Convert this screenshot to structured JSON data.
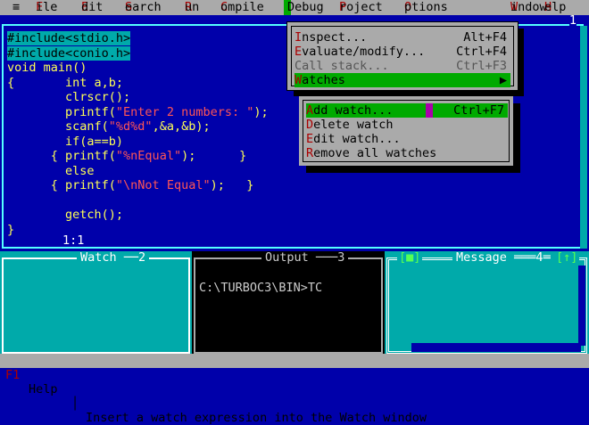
{
  "menubar": {
    "system": "≡",
    "items": [
      {
        "label": "File"
      },
      {
        "label": "Edit"
      },
      {
        "label": "Search"
      },
      {
        "label": "Run"
      },
      {
        "label": "Compile"
      },
      {
        "label": "Debug"
      },
      {
        "label": "Project"
      },
      {
        "label": "Options"
      },
      {
        "label": "Window"
      },
      {
        "label": "Help"
      }
    ]
  },
  "editor": {
    "window_number": "1",
    "cursor_pos": "1:1",
    "lines": [
      "#include<stdio.h>",
      "#include<conio.h>",
      "void main()",
      "{       int a,b;",
      "        clrscr();",
      "        printf(\"Enter 2 numbers: \");",
      "        scanf(\"%d%d\",&a,&b);",
      "        if(a==b)",
      "      { printf(\"%nEqual\");      }",
      "        else",
      "      { printf(\"\\nNot Equal\");   }",
      "",
      "        getch();",
      "}"
    ]
  },
  "debug_menu": {
    "items": [
      {
        "label": "Inspect...",
        "shortcut": "Alt+F4",
        "disabled": false
      },
      {
        "label": "Evaluate/modify...",
        "shortcut": "Ctrl+F4",
        "disabled": false
      },
      {
        "label": "Call stack...",
        "shortcut": "Ctrl+F3",
        "disabled": true
      },
      {
        "label": "Watches",
        "shortcut": "▶",
        "disabled": false,
        "selected": true
      }
    ]
  },
  "watches_submenu": {
    "items": [
      {
        "label": "Add watch...",
        "shortcut": "Ctrl+F7",
        "selected": true
      },
      {
        "label": "Delete watch"
      },
      {
        "label": "Edit watch..."
      },
      {
        "label": "Remove all watches"
      }
    ]
  },
  "panes": {
    "watch": {
      "title": "Watch",
      "number": "2"
    },
    "output": {
      "title": "Output",
      "number": "3",
      "text": "C:\\TURBOC3\\BIN>TC"
    },
    "message": {
      "title": "Message",
      "number": "4",
      "left_icon": "[■]",
      "right_icon": "[↑]"
    }
  },
  "status": {
    "key": "F1",
    "key_label": "Help",
    "hint": "Insert a watch expression into the Watch window"
  },
  "colors": {
    "desktop": "#0000aa",
    "menubar": "#aaaaaa",
    "highlight": "#00aa00",
    "hotkey": "#aa0000",
    "code": "#ffff55",
    "border": "#55ffff"
  }
}
